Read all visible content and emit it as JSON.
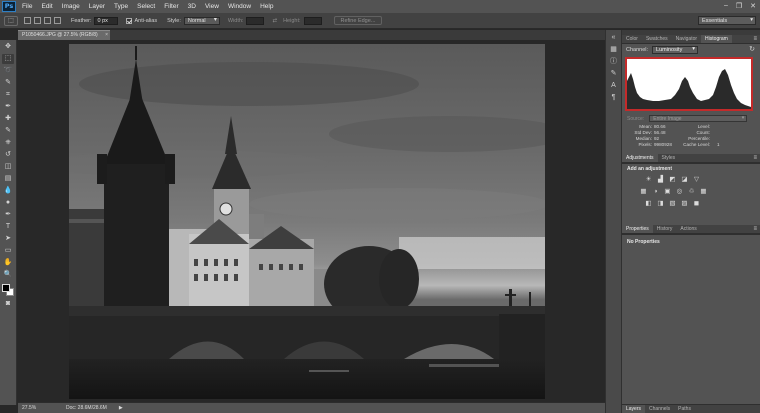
{
  "menubar": {
    "logo": "Ps",
    "items": [
      "File",
      "Edit",
      "Image",
      "Layer",
      "Type",
      "Select",
      "Filter",
      "3D",
      "View",
      "Window",
      "Help"
    ],
    "window_controls": [
      "–",
      "❐",
      "✕"
    ]
  },
  "options": {
    "feather_label": "Feather:",
    "feather_value": "0 px",
    "antialias_label": "Anti-alias",
    "style_label": "Style:",
    "style_value": "Normal",
    "width_label": "Width:",
    "height_label": "Height:",
    "refine_edge_label": "Refine Edge...",
    "workspace": "Essentials"
  },
  "document": {
    "tab_title": "P1050466.JPG @ 27.5% (RGB/8)",
    "tab_close": "×",
    "zoom": "27.5%",
    "doc_size": "Doc: 28.6M/28.6M"
  },
  "tools": [
    "move-icon",
    "marquee-icon",
    "lasso-icon",
    "quick-select-icon",
    "crop-icon",
    "eyedropper-icon",
    "healing-icon",
    "brush-icon",
    "clone-stamp-icon",
    "history-brush-icon",
    "eraser-icon",
    "gradient-icon",
    "blur-icon",
    "dodge-icon",
    "pen-icon",
    "type-icon",
    "path-select-icon",
    "shape-icon",
    "hand-icon",
    "zoom-icon"
  ],
  "tool_glyphs": [
    "✥",
    "⬚",
    "➰",
    "✎",
    "⌗",
    "✒",
    "✚",
    "✎",
    "⎈",
    "↺",
    "◫",
    "▤",
    "💧",
    "●",
    "✒",
    "T",
    "➤",
    "▭",
    "✋",
    "🔍"
  ],
  "colors": {
    "foreground": "#000000",
    "background": "#ffffff",
    "highlight": "#c42a2a"
  },
  "histogram": {
    "tabs": [
      "Color",
      "Swatches",
      "Navigator",
      "Histogram"
    ],
    "active_tab": "Histogram",
    "channel_label": "Channel:",
    "channel_value": "Luminosity",
    "source_label": "Source:",
    "source_value": "Entire Image",
    "stats": [
      {
        "label": "Mean:",
        "value": "80.66",
        "label2": "Level:",
        "value2": ""
      },
      {
        "label": "Std Dev:",
        "value": "56.48",
        "label2": "Count:",
        "value2": ""
      },
      {
        "label": "Median:",
        "value": "92",
        "label2": "Percentile:",
        "value2": ""
      },
      {
        "label": "Pixels:",
        "value": "9980928",
        "label2": "Cache Level:",
        "value2": "1"
      }
    ]
  },
  "adjustments": {
    "tabs": [
      "Adjustments",
      "Styles"
    ],
    "add_label": "Add an adjustment",
    "row1": [
      "☀",
      "▟",
      "◩",
      "◪",
      "▽"
    ],
    "row2": [
      "▦",
      "◑",
      "▣",
      "◎",
      "♲",
      "▦"
    ],
    "row3": [
      "◧",
      "◨",
      "▧",
      "▨",
      "◼"
    ]
  },
  "properties": {
    "tabs": [
      "Properties",
      "History",
      "Actions"
    ],
    "no_properties": "No Properties"
  },
  "layers": {
    "tabs": [
      "Layers",
      "Channels",
      "Paths"
    ]
  }
}
